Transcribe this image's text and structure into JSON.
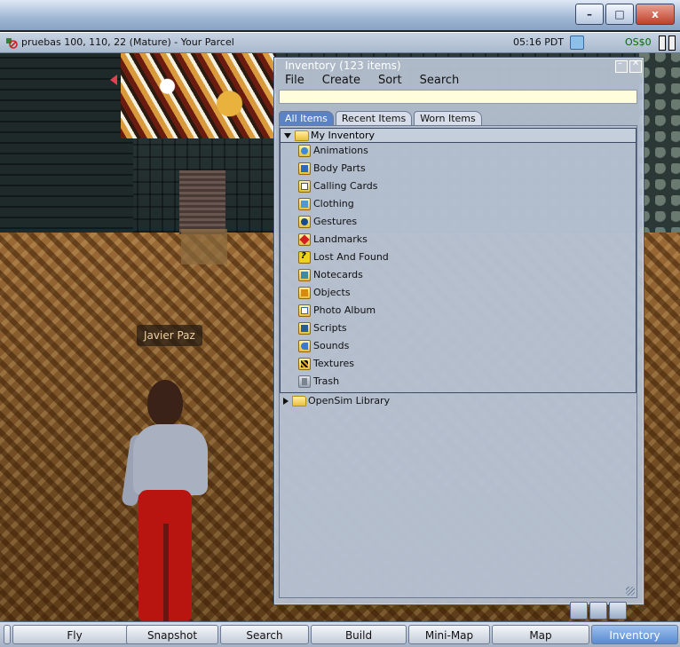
{
  "window": {
    "minimize": "–",
    "maximize": "□",
    "close": "x"
  },
  "status": {
    "location": "pruebas 100, 110, 22 (Mature) - Your Parcel",
    "time": "05:16 PDT",
    "balance": "OS$0"
  },
  "scene": {
    "avatar_name": "Javier Paz"
  },
  "inventory": {
    "title": "Inventory (123 items)",
    "menu": [
      "File",
      "Create",
      "Sort",
      "Search"
    ],
    "filter_value": "",
    "tabs": [
      {
        "label": "All Items",
        "active": true
      },
      {
        "label": "Recent Items",
        "active": false
      },
      {
        "label": "Worn Items",
        "active": false
      }
    ],
    "root_label": "My Inventory",
    "children": [
      {
        "label": "Animations",
        "icon": "animation-icon"
      },
      {
        "label": "Body Parts",
        "icon": "body-parts-icon"
      },
      {
        "label": "Calling Cards",
        "icon": "calling-card-icon"
      },
      {
        "label": "Clothing",
        "icon": "clothing-icon"
      },
      {
        "label": "Gestures",
        "icon": "gesture-icon"
      },
      {
        "label": "Landmarks",
        "icon": "landmark-icon"
      },
      {
        "label": "Lost And Found",
        "icon": "lost-and-found-icon"
      },
      {
        "label": "Notecards",
        "icon": "notecard-icon"
      },
      {
        "label": "Objects",
        "icon": "object-icon"
      },
      {
        "label": "Photo Album",
        "icon": "photo-album-icon"
      },
      {
        "label": "Scripts",
        "icon": "script-icon"
      },
      {
        "label": "Sounds",
        "icon": "sound-icon"
      },
      {
        "label": "Textures",
        "icon": "texture-icon"
      },
      {
        "label": "Trash",
        "icon": "trash-icon"
      }
    ],
    "library_label": "OpenSim Library"
  },
  "toolbar": {
    "buttons": [
      "Fly",
      "Snapshot",
      "Search",
      "Build",
      "Mini-Map",
      "Map",
      "Inventory"
    ],
    "active": "Inventory"
  },
  "colors": {
    "tab_active": "#5a82c4",
    "filter_bg": "#fffddc",
    "balance": "#006a00"
  }
}
